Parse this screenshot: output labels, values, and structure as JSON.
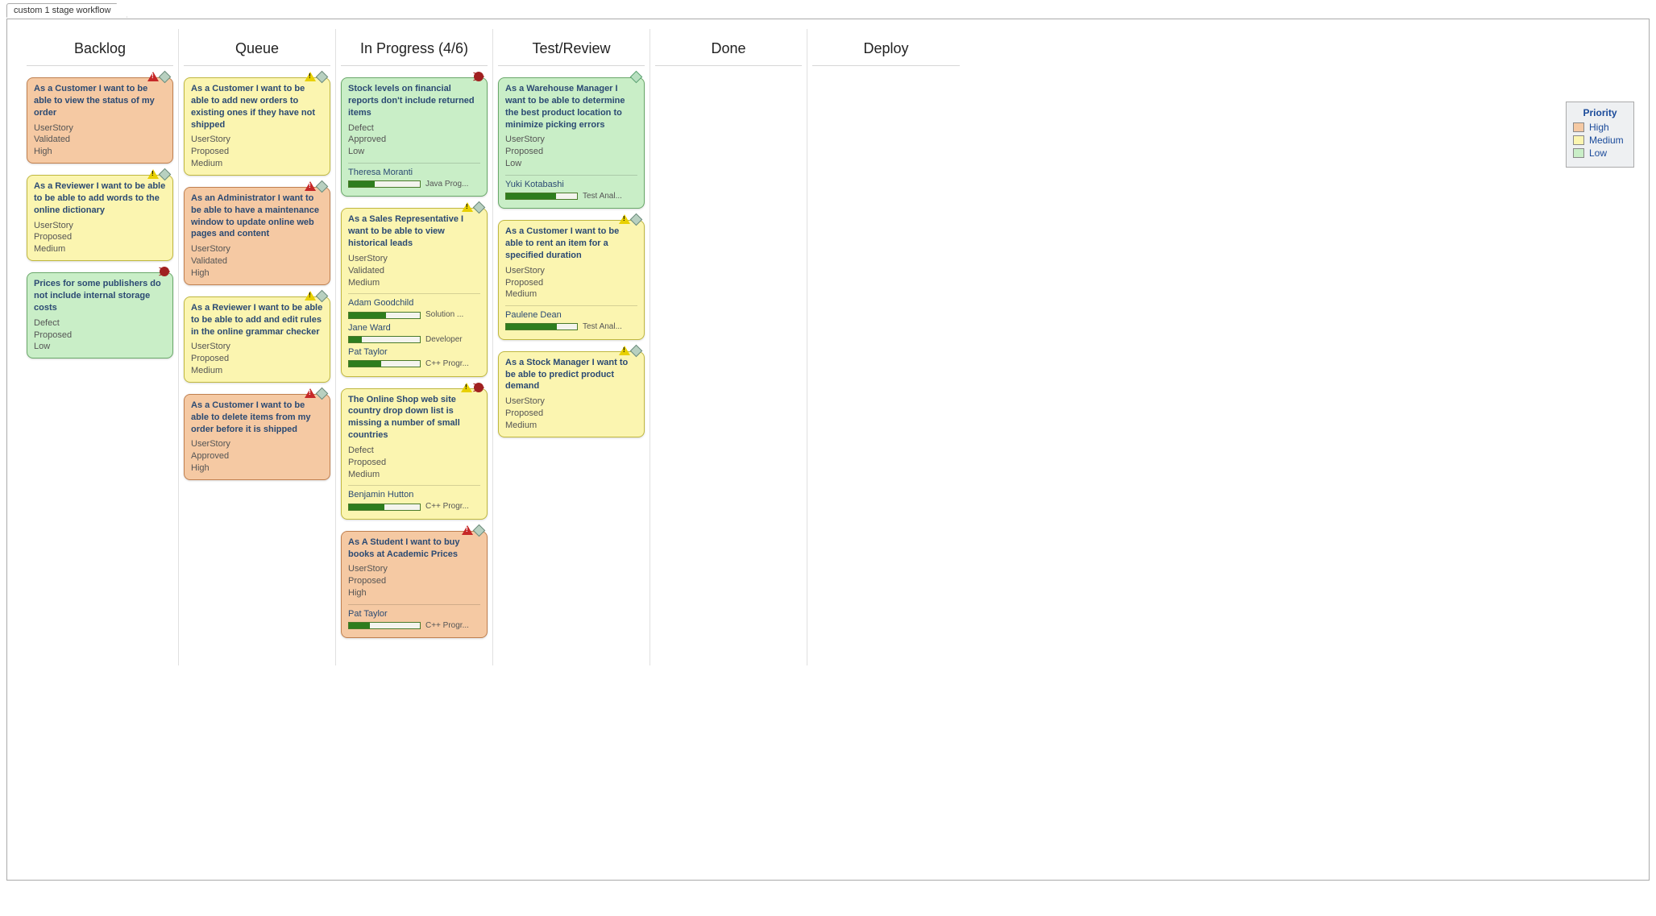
{
  "tab_label": "custom 1 stage workflow",
  "legend": {
    "title": "Priority",
    "items": [
      {
        "label": "High",
        "cls": "high"
      },
      {
        "label": "Medium",
        "cls": "medium"
      },
      {
        "label": "Low",
        "cls": "low"
      }
    ]
  },
  "columns": [
    {
      "title": "Backlog",
      "cards": [
        {
          "priority": "high",
          "title": "As a Customer I want to be able to view the status of my order",
          "type": "UserStory",
          "status": "Validated",
          "plabel": "High",
          "badges": [
            "tri-high",
            "diamond"
          ]
        },
        {
          "priority": "medium",
          "title": "As a Reviewer I want to be able to be able to add words to the online dictionary",
          "type": "UserStory",
          "status": "Proposed",
          "plabel": "Medium",
          "badges": [
            "tri-med",
            "diamond"
          ]
        },
        {
          "priority": "low",
          "title": "Prices for some publishers do not include internal storage costs",
          "type": "Defect",
          "status": "Proposed",
          "plabel": "Low",
          "badges": [
            "bug"
          ]
        }
      ]
    },
    {
      "title": "Queue",
      "cards": [
        {
          "priority": "medium",
          "title": "As a Customer I want to be able to add new orders to existing ones if they have not shipped",
          "type": "UserStory",
          "status": "Proposed",
          "plabel": "Medium",
          "badges": [
            "tri-med",
            "diamond"
          ]
        },
        {
          "priority": "high",
          "title": "As an Administrator I want to be able to have a maintenance window to update online web pages and content",
          "type": "UserStory",
          "status": "Validated",
          "plabel": "High",
          "badges": [
            "tri-high",
            "diamond"
          ]
        },
        {
          "priority": "medium",
          "title": "As a Reviewer I want to be able to be able to add and edit rules in the online grammar checker",
          "type": "UserStory",
          "status": "Proposed",
          "plabel": "Medium",
          "badges": [
            "tri-med",
            "diamond"
          ]
        },
        {
          "priority": "high",
          "title": "As a Customer I want to be able to delete items from my order before it is shipped",
          "type": "UserStory",
          "status": "Approved",
          "plabel": "High",
          "badges": [
            "tri-high",
            "diamond"
          ]
        }
      ]
    },
    {
      "title": "In Progress (4/6)",
      "cards": [
        {
          "priority": "low",
          "title": "Stock levels on financial reports don't include returned items",
          "type": "Defect",
          "status": "Approved",
          "plabel": "Low",
          "badges": [
            "bug"
          ],
          "assignees": [
            {
              "name": "Theresa Moranti",
              "progress": 36,
              "role": "Java Prog..."
            }
          ]
        },
        {
          "priority": "medium",
          "title": "As a Sales Representative I want to be able to view historical leads",
          "type": "UserStory",
          "status": "Validated",
          "plabel": "Medium",
          "badges": [
            "tri-med",
            "diamond"
          ],
          "assignees": [
            {
              "name": "Adam Goodchild",
              "progress": 52,
              "role": "Solution ..."
            },
            {
              "name": "Jane Ward",
              "progress": 18,
              "role": "Developer"
            },
            {
              "name": "Pat Taylor",
              "progress": 46,
              "role": "C++ Progr..."
            }
          ]
        },
        {
          "priority": "medium",
          "title": "The Online Shop web site country drop down list is missing a number of small countries",
          "type": "Defect",
          "status": "Proposed",
          "plabel": "Medium",
          "badges": [
            "tri-med",
            "bug"
          ],
          "assignees": [
            {
              "name": "Benjamin Hutton",
              "progress": 50,
              "role": "C++ Progr..."
            }
          ]
        },
        {
          "priority": "high",
          "title": "As A Student I want to buy books at Academic Prices",
          "type": "UserStory",
          "status": "Proposed",
          "plabel": "High",
          "badges": [
            "tri-high",
            "diamond"
          ],
          "assignees": [
            {
              "name": "Pat Taylor",
              "progress": 30,
              "role": "C++ Progr..."
            }
          ]
        }
      ]
    },
    {
      "title": "Test/Review",
      "cards": [
        {
          "priority": "low",
          "title": "As a Warehouse Manager I want to be able to determine the best product location to minimize picking errors",
          "type": "UserStory",
          "status": "Proposed",
          "plabel": "Low",
          "badges": [
            "diamond green"
          ],
          "assignees": [
            {
              "name": "Yuki Kotabashi",
              "progress": 70,
              "role": "Test Anal..."
            }
          ]
        },
        {
          "priority": "medium",
          "title": "As a Customer I want to be able to rent an item for a specified duration",
          "type": "UserStory",
          "status": "Proposed",
          "plabel": "Medium",
          "badges": [
            "tri-med",
            "diamond"
          ],
          "assignees": [
            {
              "name": "Paulene Dean",
              "progress": 72,
              "role": "Test Anal..."
            }
          ]
        },
        {
          "priority": "medium",
          "title": "As a Stock Manager I want to be able to predict product demand",
          "type": "UserStory",
          "status": "Proposed",
          "plabel": "Medium",
          "badges": [
            "tri-med",
            "diamond"
          ]
        }
      ]
    },
    {
      "title": "Done",
      "cards": []
    },
    {
      "title": "Deploy",
      "cards": []
    }
  ]
}
